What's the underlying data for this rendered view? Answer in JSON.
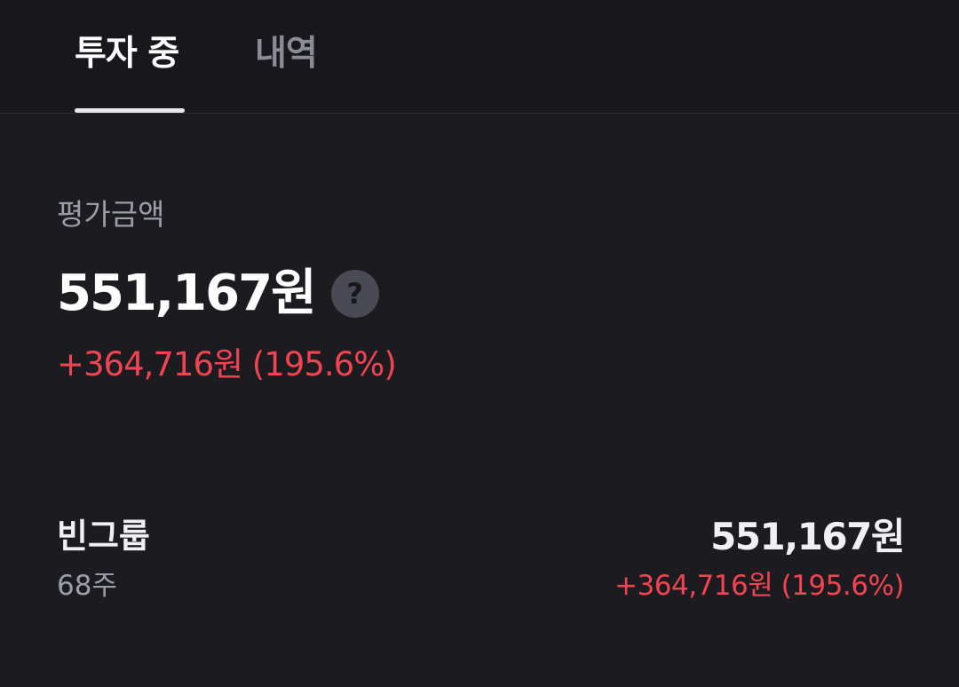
{
  "tabs": [
    {
      "label": "투자 중",
      "active": true
    },
    {
      "label": "내역",
      "active": false
    }
  ],
  "summary": {
    "label": "평가금액",
    "amount": "551,167원",
    "help_icon_glyph": "?",
    "change": "+364,716원 (195.6%)"
  },
  "holdings": [
    {
      "name": "빈그룹",
      "quantity": "68주",
      "value": "551,167원",
      "change": "+364,716원 (195.6%)"
    }
  ],
  "colors": {
    "background": "#17171c",
    "positive": "#f04452",
    "muted_text": "#9d9da6"
  },
  "icons": {
    "help": "question-circle-icon"
  }
}
